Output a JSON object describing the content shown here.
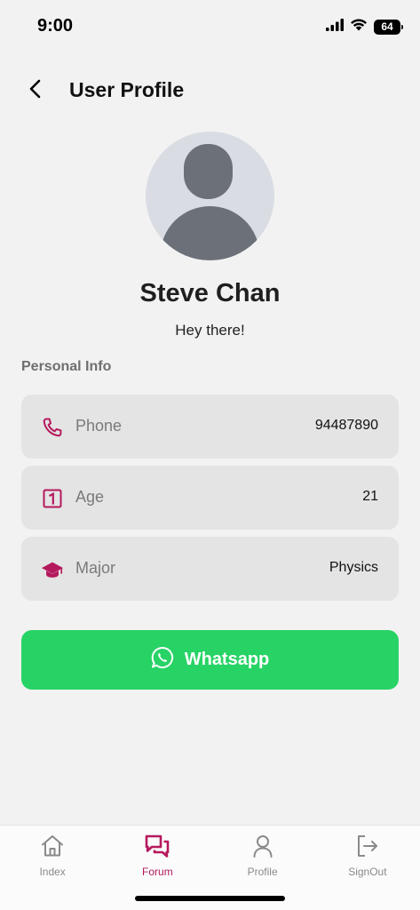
{
  "status_bar": {
    "time": "9:00",
    "battery": "64",
    "icons": [
      "cellular-signal-icon",
      "wifi-icon",
      "battery-icon"
    ]
  },
  "header": {
    "title": "User Profile",
    "back_icon": "chevron-left-icon"
  },
  "profile": {
    "name": "Steve Chan",
    "status": "Hey there!",
    "avatar_icon": "default-user-avatar"
  },
  "personal_info": {
    "section_title": "Personal Info",
    "items": [
      {
        "label": "Phone",
        "value": "94487890",
        "icon": "phone-icon"
      },
      {
        "label": "Age",
        "value": "21",
        "icon": "number-one-box-icon"
      },
      {
        "label": "Major",
        "value": "Physics",
        "icon": "graduation-cap-icon"
      }
    ]
  },
  "whatsapp_button": {
    "label": "Whatsapp",
    "icon": "whatsapp-icon"
  },
  "tab_bar": {
    "tabs": [
      {
        "label": "Index",
        "icon": "home-icon",
        "active": false
      },
      {
        "label": "Forum",
        "icon": "chat-bubbles-icon",
        "active": true
      },
      {
        "label": "Profile",
        "icon": "person-icon",
        "active": false
      },
      {
        "label": "SignOut",
        "icon": "sign-out-icon",
        "active": false
      }
    ]
  },
  "colors": {
    "background": "#f2f2f2",
    "card": "#e4e4e4",
    "accent": "#b5195d",
    "whatsapp_green": "#28d366",
    "avatar_bg": "#d9dde3",
    "avatar_figure": "#6b7079"
  }
}
